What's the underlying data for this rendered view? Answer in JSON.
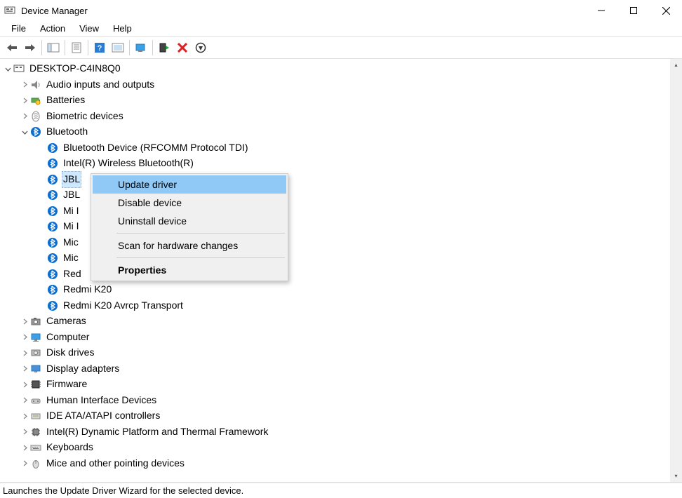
{
  "window": {
    "title": "Device Manager"
  },
  "menu": [
    "File",
    "Action",
    "View",
    "Help"
  ],
  "tree": {
    "root": {
      "label": "DESKTOP-C4IN8Q0",
      "expanded": true,
      "icon": "computer"
    },
    "children": [
      {
        "label": "Audio inputs and outputs",
        "expanded": false,
        "icon": "speaker"
      },
      {
        "label": "Batteries",
        "expanded": false,
        "icon": "battery"
      },
      {
        "label": "Biometric devices",
        "expanded": false,
        "icon": "biometric"
      },
      {
        "label": "Bluetooth",
        "expanded": true,
        "icon": "bluetooth",
        "children": [
          {
            "label": "Bluetooth Device (RFCOMM Protocol TDI)",
            "icon": "bluetooth"
          },
          {
            "label": "Intel(R) Wireless Bluetooth(R)",
            "icon": "bluetooth"
          },
          {
            "label": "JBL",
            "icon": "bluetooth",
            "selected": true,
            "truncated": true
          },
          {
            "label": "JBL",
            "icon": "bluetooth",
            "truncated": true
          },
          {
            "label": "Mi I",
            "icon": "bluetooth",
            "truncated": true
          },
          {
            "label": "Mi I",
            "icon": "bluetooth",
            "truncated": true
          },
          {
            "label": "Mic",
            "icon": "bluetooth",
            "truncated": true
          },
          {
            "label": "Mic",
            "icon": "bluetooth",
            "truncated": true
          },
          {
            "label": "Red",
            "icon": "bluetooth",
            "truncated": true
          },
          {
            "label": "Redmi K20",
            "icon": "bluetooth",
            "truncated_by_menu_bottom": true
          },
          {
            "label": "Redmi K20 Avrcp Transport",
            "icon": "bluetooth"
          }
        ]
      },
      {
        "label": "Cameras",
        "expanded": false,
        "icon": "camera"
      },
      {
        "label": "Computer",
        "expanded": false,
        "icon": "monitor"
      },
      {
        "label": "Disk drives",
        "expanded": false,
        "icon": "disk"
      },
      {
        "label": "Display adapters",
        "expanded": false,
        "icon": "display"
      },
      {
        "label": "Firmware",
        "expanded": false,
        "icon": "firmware"
      },
      {
        "label": "Human Interface Devices",
        "expanded": false,
        "icon": "hid"
      },
      {
        "label": "IDE ATA/ATAPI controllers",
        "expanded": false,
        "icon": "ide"
      },
      {
        "label": "Intel(R) Dynamic Platform and Thermal Framework",
        "expanded": false,
        "icon": "chip"
      },
      {
        "label": "Keyboards",
        "expanded": false,
        "icon": "keyboard"
      },
      {
        "label": "Mice and other pointing devices",
        "expanded": false,
        "icon": "mouse"
      }
    ]
  },
  "context_menu": {
    "items": [
      {
        "label": "Update driver",
        "hover": true
      },
      {
        "label": "Disable device"
      },
      {
        "label": "Uninstall device"
      },
      {
        "sep": true
      },
      {
        "label": "Scan for hardware changes"
      },
      {
        "sep": true
      },
      {
        "label": "Properties",
        "bold": true
      }
    ]
  },
  "status": "Launches the Update Driver Wizard for the selected device."
}
